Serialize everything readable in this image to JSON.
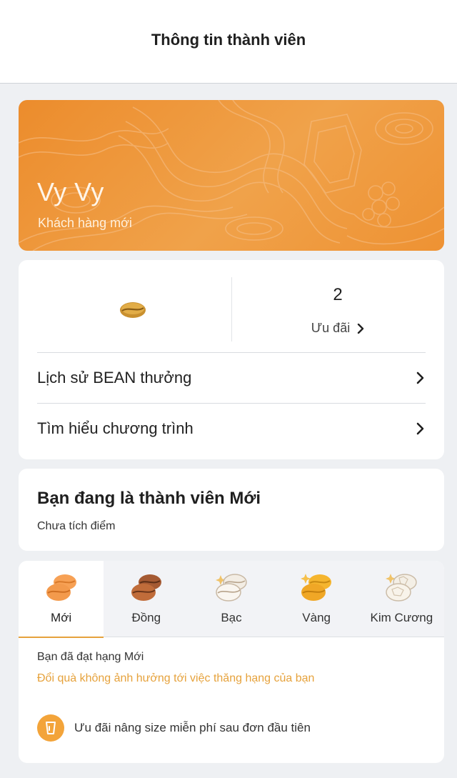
{
  "header": {
    "title": "Thông tin thành viên"
  },
  "member": {
    "name": "Vy Vy",
    "tier": "Khách hàng mới"
  },
  "stats": {
    "bean_icon": "coffee-bean-icon",
    "offer_count": "2",
    "offer_label": "Ưu đãi"
  },
  "menu": {
    "history": "Lịch sử BEAN thưởng",
    "program": "Tìm hiểu chương trình"
  },
  "status": {
    "heading": "Bạn đang là thành viên Mới",
    "sub": "Chưa tích điểm"
  },
  "tiers": {
    "tabs": [
      {
        "label": "Mới",
        "icon": "bean-new-icon",
        "active": true
      },
      {
        "label": "Đồng",
        "icon": "bean-bronze-icon",
        "active": false
      },
      {
        "label": "Bạc",
        "icon": "bean-silver-icon",
        "active": false
      },
      {
        "label": "Vàng",
        "icon": "bean-gold-icon",
        "active": false
      },
      {
        "label": "Kim Cương",
        "icon": "bean-diamond-icon",
        "active": false
      }
    ],
    "achieved": "Bạn đã đạt hạng Mới",
    "note": "Đổi quà không ảnh hưởng tới việc thăng hạng của bạn",
    "perk": "Ưu đãi nâng size miễn phí sau đơn đầu tiên"
  },
  "colors": {
    "accent": "#e6a23c",
    "card_orange": "#ee9233",
    "background": "#eef0f3"
  }
}
